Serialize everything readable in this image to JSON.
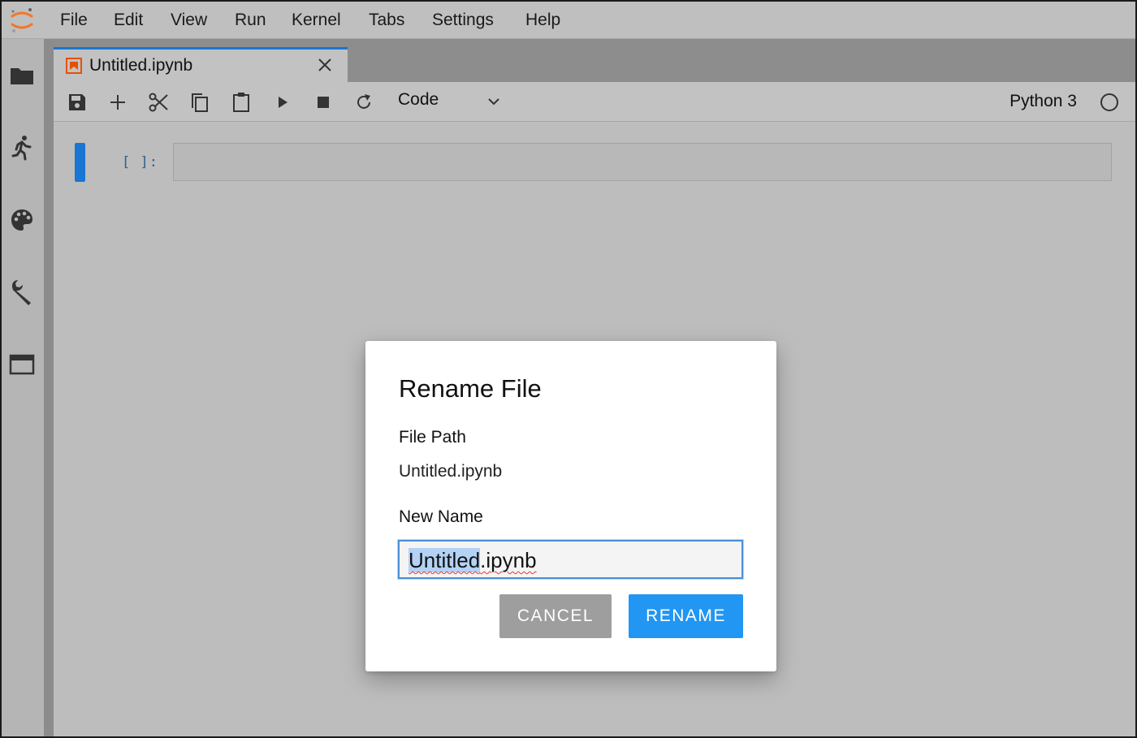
{
  "menubar": {
    "logo": "jupyter-logo",
    "items": [
      "File",
      "Edit",
      "View",
      "Run",
      "Kernel",
      "Tabs",
      "Settings",
      "Help"
    ]
  },
  "sidebar": {
    "icons": [
      "folder-icon",
      "running-icon",
      "palette-icon",
      "wrench-icon",
      "tabs-icon"
    ]
  },
  "tab": {
    "title": "Untitled.ipynb",
    "icon": "notebook-icon",
    "close": "close-icon"
  },
  "toolbar": {
    "buttons": [
      "save-icon",
      "add-icon",
      "cut-icon",
      "copy-icon",
      "paste-icon",
      "run-icon",
      "stop-icon",
      "restart-icon"
    ],
    "cell_type": "Code",
    "kernel_name": "Python 3",
    "kernel_status": "idle"
  },
  "cell": {
    "prompt": "[ ]:"
  },
  "dialog": {
    "title": "Rename File",
    "path_label": "File Path",
    "path_value": "Untitled.ipynb",
    "name_label": "New Name",
    "input_selected": "Untitled",
    "input_rest": ".ipynb",
    "cancel_label": "CANCEL",
    "rename_label": "RENAME"
  },
  "colors": {
    "accent": "#1976d2",
    "rename_button": "#2196f3",
    "cancel_button": "#9e9e9e",
    "logo": "#f37626"
  }
}
